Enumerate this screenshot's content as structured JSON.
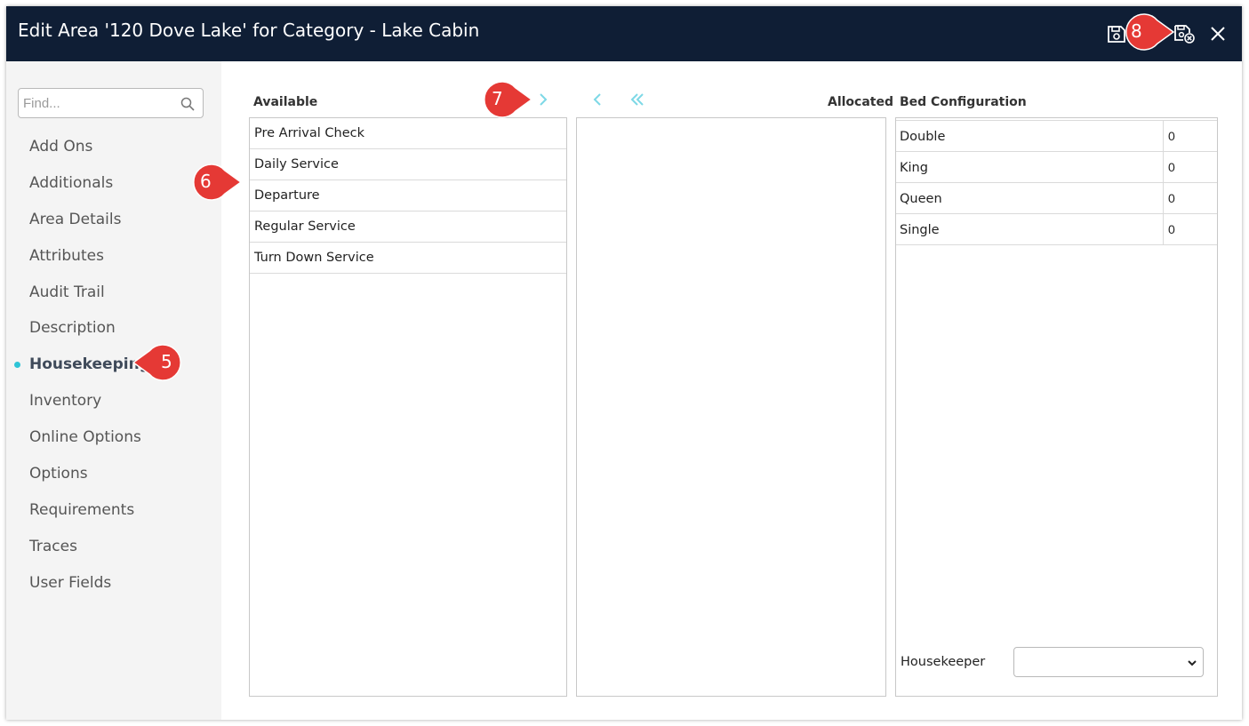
{
  "window": {
    "title": "Edit Area '120 Dove Lake' for Category - Lake Cabin"
  },
  "toolbar": {
    "save_icon": "save-icon",
    "save_close_icon": "save-close-icon",
    "close_icon": "close-icon"
  },
  "sidebar": {
    "search": {
      "placeholder": "Find...",
      "value": ""
    },
    "items": [
      {
        "label": "Add Ons"
      },
      {
        "label": "Additionals"
      },
      {
        "label": "Area Details"
      },
      {
        "label": "Attributes"
      },
      {
        "label": "Audit Trail"
      },
      {
        "label": "Description"
      },
      {
        "label": "Housekeeping",
        "active": true
      },
      {
        "label": "Inventory"
      },
      {
        "label": "Online Options"
      },
      {
        "label": "Options"
      },
      {
        "label": "Requirements"
      },
      {
        "label": "Traces"
      },
      {
        "label": "User Fields"
      }
    ]
  },
  "main": {
    "available_label": "Available",
    "allocated_label": "Allocated",
    "bed_config_label": "Bed Configuration",
    "available_items": [
      "Pre Arrival Check",
      "Daily Service",
      "Departure",
      "Regular Service",
      "Turn Down Service"
    ],
    "allocated_items": [],
    "bed_configuration": [
      {
        "name": "Double",
        "value": "0"
      },
      {
        "name": "King",
        "value": "0"
      },
      {
        "name": "Queen",
        "value": "0"
      },
      {
        "name": "Single",
        "value": "0"
      }
    ],
    "housekeeper_label": "Housekeeper",
    "housekeeper_value": ""
  },
  "callouts": [
    "5",
    "6",
    "7",
    "8"
  ],
  "colors": {
    "titlebar": "#0f1e35",
    "accent": "#2ec4d6",
    "callout": "#e53935"
  }
}
